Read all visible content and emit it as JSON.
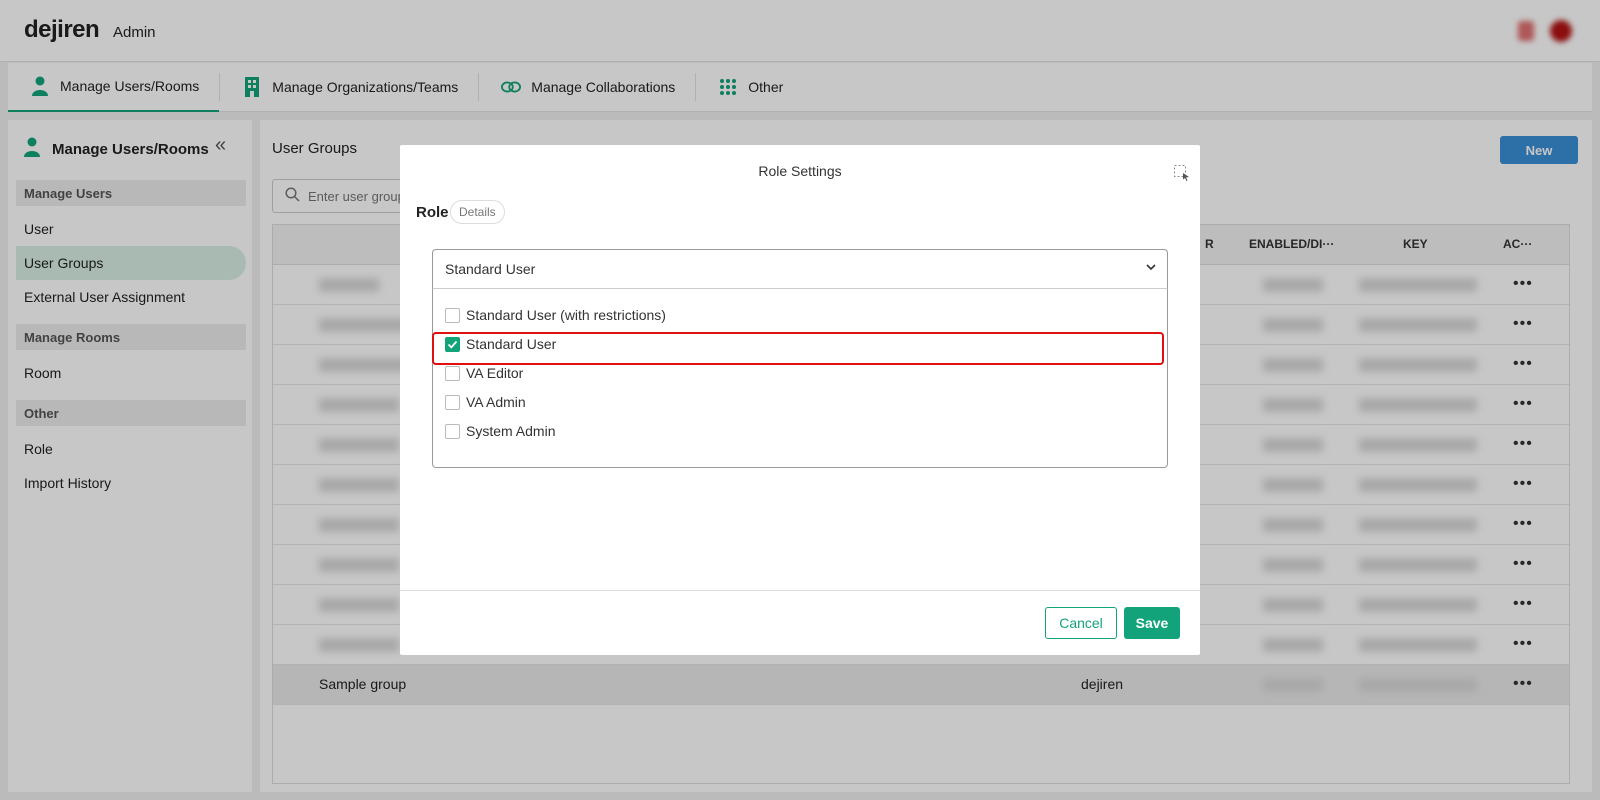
{
  "header": {
    "logo": "dejiren",
    "app_label": "Admin"
  },
  "tabs": [
    {
      "label": "Manage Users/Rooms",
      "icon": "user-icon",
      "active": true
    },
    {
      "label": "Manage Organizations/Teams",
      "icon": "building-icon",
      "active": false
    },
    {
      "label": "Manage Collaborations",
      "icon": "link-icon",
      "active": false
    },
    {
      "label": "Other",
      "icon": "grid-icon",
      "active": false
    }
  ],
  "sidebar": {
    "title": "Manage Users/Rooms",
    "sections": [
      {
        "label": "Manage Users"
      },
      {
        "label": "Manage Rooms"
      },
      {
        "label": "Other"
      }
    ],
    "items": [
      {
        "label": "User"
      },
      {
        "label": "User Groups",
        "active": true
      },
      {
        "label": "External User Assignment"
      },
      {
        "label": "Room"
      },
      {
        "label": "Role"
      },
      {
        "label": "Import History"
      }
    ]
  },
  "content": {
    "title": "User Groups",
    "new_label": "New",
    "search_placeholder": "Enter user group",
    "columns": {
      "owner_partial": "R",
      "enabled": "ENABLED/DI···",
      "key": "KEY",
      "actions": "AC···"
    },
    "sample_row": {
      "name": "Sample group",
      "owner": "dejiren"
    }
  },
  "modal": {
    "title": "Role Settings",
    "role_label": "Role",
    "details_label": "Details",
    "selected_value": "Standard User",
    "options": [
      {
        "label": "Standard User (with restrictions)",
        "checked": false
      },
      {
        "label": "Standard User",
        "checked": true
      },
      {
        "label": "VA Editor",
        "checked": false
      },
      {
        "label": "VA Admin",
        "checked": false
      },
      {
        "label": "System Admin",
        "checked": false
      }
    ],
    "cancel_label": "Cancel",
    "save_label": "Save"
  },
  "colors": {
    "accent": "#13a37a",
    "highlight": "#e01010",
    "new_button": "#3a8fd6"
  }
}
